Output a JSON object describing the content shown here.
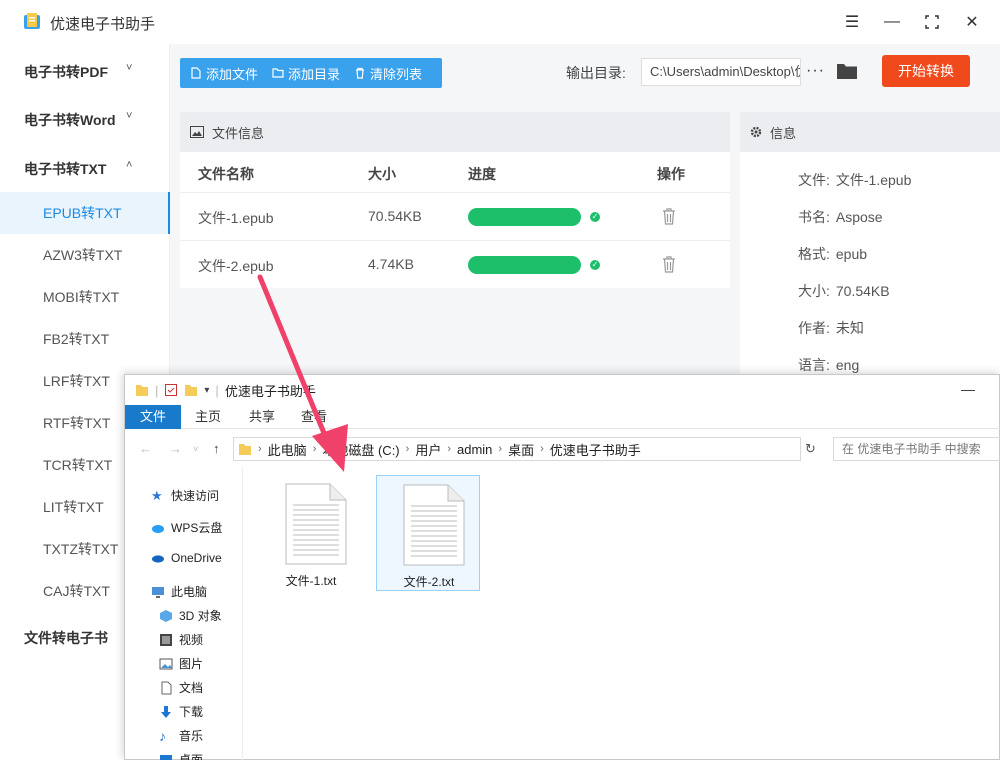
{
  "app": {
    "title": "优速电子书助手"
  },
  "sidebar": {
    "groups": [
      {
        "label": "电子书转PDF",
        "chevron": "˅"
      },
      {
        "label": "电子书转Word",
        "chevron": "˅"
      },
      {
        "label": "电子书转TXT",
        "chevron": "˄"
      },
      {
        "label": "文件转电子书"
      }
    ],
    "items": [
      {
        "label": "EPUB转TXT",
        "active": true
      },
      {
        "label": "AZW3转TXT"
      },
      {
        "label": "MOBI转TXT"
      },
      {
        "label": "FB2转TXT"
      },
      {
        "label": "LRF转TXT"
      },
      {
        "label": "RTF转TXT"
      },
      {
        "label": "TCR转TXT"
      },
      {
        "label": "LIT转TXT"
      },
      {
        "label": "TXTZ转TXT"
      },
      {
        "label": "CAJ转TXT"
      }
    ]
  },
  "toolbar": {
    "add_file": "添加文件",
    "add_dir": "添加目录",
    "clear_list": "清除列表",
    "output_label": "输出目录:",
    "output_path": "C:\\Users\\admin\\Desktop\\优速电子书助手",
    "more": "···",
    "start": "开始转换"
  },
  "file_panel": {
    "title": "文件信息",
    "headers": {
      "name": "文件名称",
      "size": "大小",
      "progress": "进度",
      "action": "操作"
    },
    "rows": [
      {
        "name": "文件-1.epub",
        "size": "70.54KB",
        "progress": 1.0
      },
      {
        "name": "文件-2.epub",
        "size": "4.74KB",
        "progress": 1.0
      }
    ]
  },
  "info_panel": {
    "title": "信息",
    "rows": [
      {
        "label": "文件:",
        "value": "文件-1.epub"
      },
      {
        "label": "书名:",
        "value": "Aspose"
      },
      {
        "label": "格式:",
        "value": "epub"
      },
      {
        "label": "大小:",
        "value": "70.54KB"
      },
      {
        "label": "作者:",
        "value": "未知"
      },
      {
        "label": "语言:",
        "value": "eng"
      }
    ]
  },
  "explorer": {
    "title": "优速电子书助手",
    "minimize": "—",
    "ribbon": [
      "文件",
      "主页",
      "共享",
      "查看"
    ],
    "address": [
      "此电脑",
      "本地磁盘 (C:)",
      "用户",
      "admin",
      "桌面",
      "优速电子书助手"
    ],
    "search_placeholder": "在 优速电子书助手 中搜索",
    "nav": [
      {
        "label": "快速访问",
        "icon": "star-icon"
      },
      {
        "label": "WPS云盘",
        "icon": "cloud-icon"
      },
      {
        "label": "OneDrive",
        "icon": "onedrive-icon"
      },
      {
        "label": "此电脑",
        "icon": "computer-icon"
      },
      {
        "label": "3D 对象",
        "icon": "cube-icon"
      },
      {
        "label": "视频",
        "icon": "video-icon"
      },
      {
        "label": "图片",
        "icon": "picture-icon"
      },
      {
        "label": "文档",
        "icon": "document-icon"
      },
      {
        "label": "下载",
        "icon": "download-icon"
      },
      {
        "label": "音乐",
        "icon": "music-icon"
      },
      {
        "label": "桌面",
        "icon": "desktop-icon"
      }
    ],
    "files": [
      {
        "name": "文件-1.txt",
        "selected": false
      },
      {
        "name": "文件-2.txt",
        "selected": true
      }
    ]
  },
  "colors": {
    "accent": "#3aa1ec",
    "start_button": "#f04a1c",
    "progress": "#1dbf6b",
    "annotation_arrow": "#f0416a"
  }
}
